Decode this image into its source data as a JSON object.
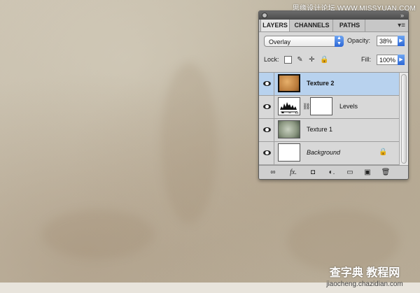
{
  "watermark": {
    "top": "思缘设计论坛 WWW.MISSYUAN.COM",
    "bottom_big": "查字典 教程网",
    "bottom_small": "jiaocheng.chazidian.com"
  },
  "panel": {
    "tabs": [
      "LAYERS",
      "CHANNELS",
      "PATHS"
    ],
    "menu_icon": "panel-menu-icon",
    "blend_mode": "Overlay",
    "opacity_label": "Opacity:",
    "opacity_value": "38%",
    "lock_label": "Lock:",
    "fill_label": "Fill:",
    "fill_value": "100%",
    "layers": [
      {
        "name": "Texture 2",
        "selected": true
      },
      {
        "name": "Levels",
        "selected": false
      },
      {
        "name": "Texture 1",
        "selected": false
      },
      {
        "name": "Background",
        "selected": false
      }
    ],
    "bottom_icons": [
      "link-layers-icon",
      "fx-icon",
      "add-mask-icon",
      "adjustment-layer-icon",
      "new-group-icon",
      "new-layer-icon",
      "trash-icon"
    ]
  },
  "colors": {
    "selected_row": "#b8d2ee",
    "accent_blue": "#2c67d6"
  }
}
